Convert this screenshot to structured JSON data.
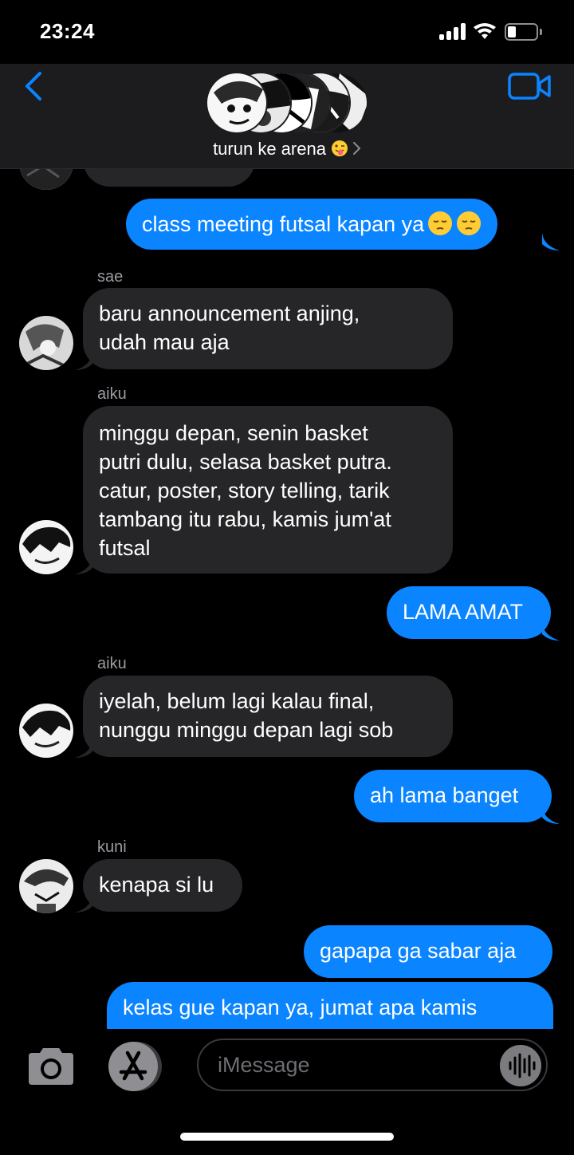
{
  "status_bar": {
    "time": "23:24",
    "battery_level": 0.3
  },
  "header": {
    "group_name": "turun ke arena",
    "group_emoji": "winking-tongue-emoji"
  },
  "messages": [
    {
      "direction": "in",
      "text": ""
    },
    {
      "direction": "out",
      "text": "class meeting futsal kapan ya",
      "emoji": "pensive-emoji pensive-emoji"
    },
    {
      "direction": "in",
      "sender": "sae",
      "lines": [
        "baru announcement anjing,",
        "udah mau aja"
      ]
    },
    {
      "direction": "in",
      "sender": "aiku",
      "lines": [
        "minggu depan, senin basket",
        "putri dulu, selasa basket putra.",
        "catur, poster, story telling, tarik",
        "tambang itu rabu, kamis jum'at",
        "futsal"
      ]
    },
    {
      "direction": "out",
      "text": "LAMA AMAT"
    },
    {
      "direction": "in",
      "sender": "aiku",
      "lines": [
        "iyelah, belum lagi kalau final,",
        "nunggu minggu depan lagi sob"
      ]
    },
    {
      "direction": "out",
      "text": "ah lama banget"
    },
    {
      "direction": "in",
      "sender": "kuni",
      "text": "kenapa si lu"
    },
    {
      "direction": "out",
      "text": "gapapa ga sabar aja"
    },
    {
      "direction": "out",
      "text": "kelas gue kapan ya, jumat apa kamis"
    }
  ],
  "composer": {
    "placeholder": "iMessage"
  },
  "colors": {
    "outgoing_bubble": "#0a84ff",
    "incoming_bubble": "#262628",
    "accent": "#0a84ff"
  },
  "icons": [
    "back-chevron-icon",
    "video-camera-icon",
    "camera-icon",
    "app-store-icon",
    "audio-waveform-icon"
  ]
}
